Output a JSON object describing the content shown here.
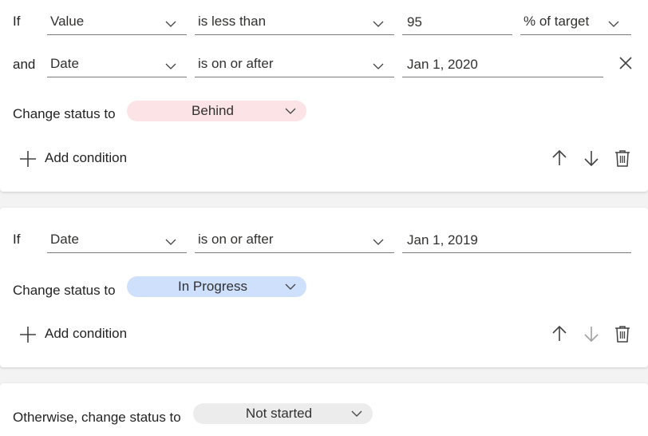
{
  "rule1": {
    "row1": {
      "prefix": "If",
      "field": "Value",
      "operator": "is less than",
      "value": "95",
      "unit": "% of target"
    },
    "row2": {
      "prefix": "and",
      "field": "Date",
      "operator": "is on or after",
      "value": "Jan 1, 2020"
    },
    "status_label": "Change status to",
    "status": "Behind",
    "status_color": "#fbe3e6",
    "add_condition": "Add condition"
  },
  "rule2": {
    "row1": {
      "prefix": "If",
      "field": "Date",
      "operator": "is on or after",
      "value": "Jan 1, 2019"
    },
    "status_label": "Change status to",
    "status": "In Progress",
    "status_color": "#cfe0fd",
    "add_condition": "Add condition"
  },
  "otherwise": {
    "label": "Otherwise, change status to",
    "status": "Not started",
    "status_color": "#ececec"
  },
  "icons": {
    "chevron": "chevron-down-icon",
    "close": "close-icon",
    "add": "add-icon",
    "up": "arrow-up-icon",
    "down": "arrow-down-icon",
    "delete": "trash-icon"
  }
}
